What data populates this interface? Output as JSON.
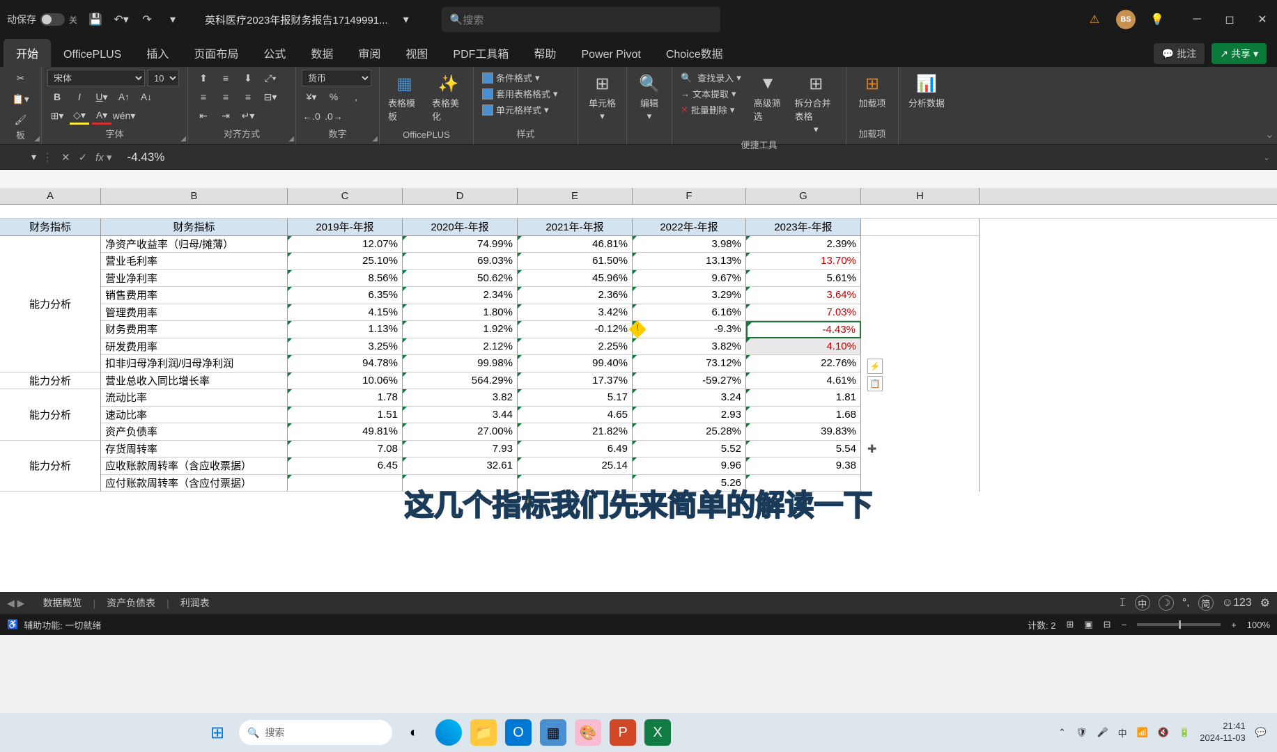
{
  "title_bar": {
    "auto_save": "动保存",
    "toggle_label": "关",
    "doc_title": "英科医疗2023年报财务报告17149991...",
    "search_placeholder": "搜索",
    "user_initials": "BS"
  },
  "tabs": {
    "start": "开始",
    "officeplus": "OfficePLUS",
    "insert": "插入",
    "layout": "页面布局",
    "formula": "公式",
    "data": "数据",
    "review": "审阅",
    "view": "视图",
    "pdf": "PDF工具箱",
    "help": "帮助",
    "pivot": "Power Pivot",
    "choice": "Choice数据",
    "comment": "批注",
    "share": "共享"
  },
  "ribbon": {
    "font_name": "宋体",
    "font_size": "10",
    "font_group": "字体",
    "clipboard_group": "板",
    "align_group": "对齐方式",
    "number_format": "货币",
    "number_group": "数字",
    "tpl1": "表格模板",
    "tpl2": "表格美化",
    "officeplus_group": "OfficePLUS",
    "cond_fmt": "条件格式",
    "cell_fmt": "套用表格格式",
    "cell_style": "单元格样式",
    "style_group": "样式",
    "cells": "单元格",
    "edit": "编辑",
    "find": "查找录入",
    "extract": "文本提取",
    "batch_del": "批量删除",
    "filter": "高级筛选",
    "split": "拆分合并表格",
    "tools_group": "便捷工具",
    "addin": "加载项",
    "addin_group": "加载项",
    "analyze": "分析数据"
  },
  "formula_bar": {
    "value": "-4.43%",
    "fx": "fx"
  },
  "columns": {
    "A": "A",
    "B": "B",
    "C": "C",
    "D": "D",
    "E": "E",
    "F": "F",
    "G": "G",
    "H": "H"
  },
  "headers": {
    "a": "财务指标",
    "b": "财务指标",
    "c": "2019年-年报",
    "d": "2020年-年报",
    "e": "2021年-年报",
    "f": "2022年-年报",
    "g": "2023年-年报"
  },
  "groups": {
    "g1": "能力分析",
    "g2": "能力分析",
    "g3": "能力分析",
    "g4": "能力分析"
  },
  "rows": [
    {
      "n": "净资产收益率（归母/摊薄）",
      "c": "12.07%",
      "d": "74.99%",
      "e": "46.81%",
      "f": "3.98%",
      "g": "2.39%"
    },
    {
      "n": "营业毛利率",
      "c": "25.10%",
      "d": "69.03%",
      "e": "61.50%",
      "f": "13.13%",
      "g": "13.70%",
      "gred": true
    },
    {
      "n": "营业净利率",
      "c": "8.56%",
      "d": "50.62%",
      "e": "45.96%",
      "f": "9.67%",
      "g": "5.61%"
    },
    {
      "n": "销售费用率",
      "c": "6.35%",
      "d": "2.34%",
      "e": "2.36%",
      "f": "3.29%",
      "g": "3.64%",
      "gred": true
    },
    {
      "n": "管理费用率",
      "c": "4.15%",
      "d": "1.80%",
      "e": "3.42%",
      "f": "6.16%",
      "g": "7.03%",
      "gred": true
    },
    {
      "n": "财务费用率",
      "c": "1.13%",
      "d": "1.92%",
      "e": "-0.12%",
      "f": "-9.3%",
      "fwarn": true,
      "g": "-4.43%",
      "gred": true,
      "gsel": true
    },
    {
      "n": "研发费用率",
      "c": "3.25%",
      "d": "2.12%",
      "e": "2.25%",
      "f": "3.82%",
      "g": "4.10%",
      "gred": true,
      "gsel2": true
    },
    {
      "n": "扣非归母净利润/归母净利润",
      "c": "94.78%",
      "d": "99.98%",
      "e": "99.40%",
      "f": "73.12%",
      "g": "22.76%"
    },
    {
      "n": "营业总收入同比增长率",
      "c": "10.06%",
      "d": "564.29%",
      "e": "17.37%",
      "f": "-59.27%",
      "g": "4.61%"
    },
    {
      "n": "流动比率",
      "c": "1.78",
      "d": "3.82",
      "e": "5.17",
      "f": "3.24",
      "g": "1.81"
    },
    {
      "n": "速动比率",
      "c": "1.51",
      "d": "3.44",
      "e": "4.65",
      "f": "2.93",
      "g": "1.68"
    },
    {
      "n": "资产负债率",
      "c": "49.81%",
      "d": "27.00%",
      "e": "21.82%",
      "f": "25.28%",
      "g": "39.83%"
    },
    {
      "n": "存货周转率",
      "c": "7.08",
      "d": "7.93",
      "e": "6.49",
      "f": "5.52",
      "g": "5.54"
    },
    {
      "n": "应收账款周转率（含应收票据）",
      "c": "6.45",
      "d": "32.61",
      "e": "25.14",
      "f": "9.96",
      "g": "9.38"
    },
    {
      "n": "应付账款周转率（含应付票据）",
      "c": "",
      "d": "",
      "e": "",
      "f": "5.26",
      "g": ""
    }
  ],
  "caption": "这几个指标我们先来简单的解读一下",
  "sheet_tabs": {
    "t1": "数据概览",
    "t2": "资产负债表",
    "t3": "利润表"
  },
  "status": {
    "ready": "辅助功能: 一切就绪",
    "count": "计数: 2",
    "zoom": "100%"
  },
  "ime": {
    "zhong": "中",
    "jian": "简"
  },
  "taskbar": {
    "search": "搜索",
    "time": "21:41",
    "date": "2024-11-03",
    "lang": "中"
  }
}
